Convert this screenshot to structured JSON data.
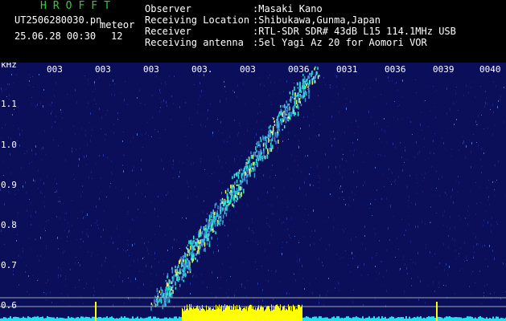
{
  "header": {
    "logo": "HROFFT",
    "filename": "UT2506280030.pn",
    "mode": "meteor",
    "datetime": "25.06.28 00:30",
    "count": "12",
    "info": [
      {
        "label": "Observer",
        "value": ":Masaki Kano"
      },
      {
        "label": "Receiving Location",
        "value": ":Shibukawa,Gunma,Japan"
      },
      {
        "label": "Receiver",
        "value": ":RTL-SDR SDR# 43dB L15 114.1MHz USB"
      },
      {
        "label": "Receiving antenna",
        "value": ":5el Yagi Az 20 for Aomori VOR"
      }
    ]
  },
  "plot": {
    "y_unit": "kHz",
    "y_ticks": [
      "1.1",
      "1.0",
      "0.9",
      "0.8",
      "0.7",
      "0.6"
    ],
    "time_ticks": [
      "003",
      "003",
      "003",
      "003.",
      "003",
      "0036",
      "0031",
      "0036",
      "0039",
      "0040"
    ],
    "colors": {
      "background": "#0b0f5a",
      "trace": "#2ee6d6",
      "meteor": "#f0f060",
      "baseline": "#21e0f0",
      "burst": "#ffff00"
    }
  }
}
